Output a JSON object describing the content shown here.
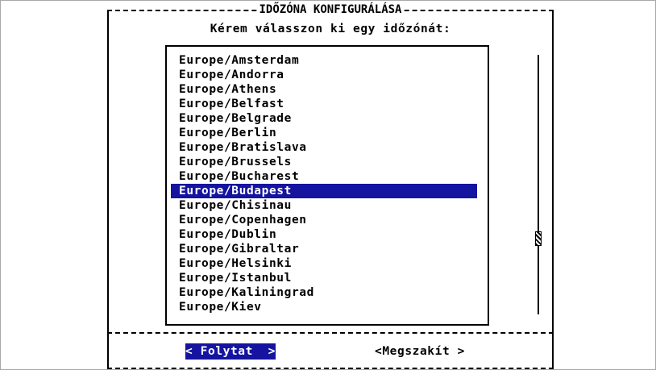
{
  "dialog": {
    "title": "IDŐZÓNA KONFIGURÁLÁSA",
    "prompt": "Kérem válasszon ki egy időzónát:"
  },
  "timezones": [
    "Europe/Amsterdam",
    "Europe/Andorra",
    "Europe/Athens",
    "Europe/Belfast",
    "Europe/Belgrade",
    "Europe/Berlin",
    "Europe/Bratislava",
    "Europe/Brussels",
    "Europe/Bucharest",
    "Europe/Budapest",
    "Europe/Chisinau",
    "Europe/Copenhagen",
    "Europe/Dublin",
    "Europe/Gibraltar",
    "Europe/Helsinki",
    "Europe/Istanbul",
    "Europe/Kaliningrad",
    "Europe/Kiev"
  ],
  "selected_timezone": "Europe/Budapest",
  "scroll_position": 0.72,
  "buttons": {
    "continue_label": "< Folytat  >",
    "cancel_label": "<Megszakít >"
  },
  "colors": {
    "highlight": "#1414a0",
    "highlight_text": "#ffffff"
  }
}
